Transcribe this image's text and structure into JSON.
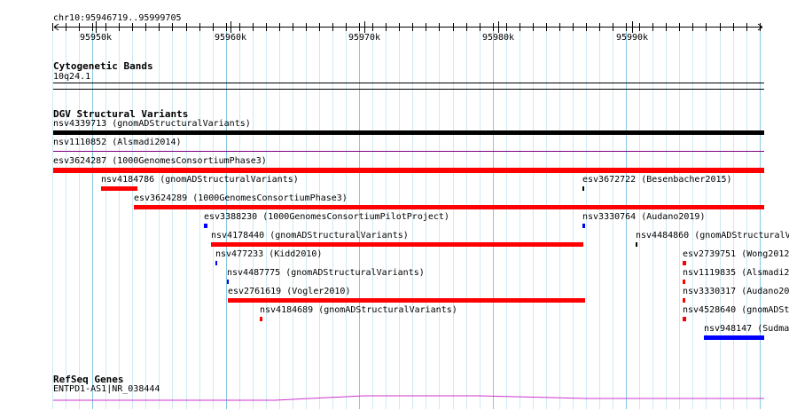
{
  "region": "chr10:95946719..95999705",
  "ruler": {
    "ticks": [
      "95950k",
      "95960k",
      "95970k",
      "95980k",
      "95990k"
    ]
  },
  "cytoband": {
    "title": "Cytogenetic Bands",
    "band": "10q24.1"
  },
  "dgv": {
    "title": "DGV Structural Variants",
    "colors": {
      "loss": "#ff0000",
      "gain": "#0000ff",
      "complex": "#000000",
      "inversion": "#800080"
    },
    "variants": [
      {
        "label": "nsv4339713 (gnomADStructuralVariants)",
        "type": "complex"
      },
      {
        "label": "nsv1110852 (Alsmadi2014)",
        "type": "inversion"
      },
      {
        "label": "esv3624287 (1000GenomesConsortiumPhase3)",
        "type": "loss"
      },
      {
        "label": "nsv4184786 (gnomADStructuralVariants)",
        "type": "loss"
      },
      {
        "label": "esv3672722 (Besenbacher2015)",
        "type": "complex"
      },
      {
        "label": "esv3624289 (1000GenomesConsortiumPhase3)",
        "type": "loss"
      },
      {
        "label": "esv3388230 (1000GenomesConsortiumPilotProject)",
        "type": "gain"
      },
      {
        "label": "nsv3330764 (Audano2019)",
        "type": "gain"
      },
      {
        "label": "nsv4178440 (gnomADStructuralVariants)",
        "type": "loss"
      },
      {
        "label": "nsv4484860 (gnomADStructuralV",
        "type": "complex"
      },
      {
        "label": "nsv477233 (Kidd2010)",
        "type": "gain"
      },
      {
        "label": "esv2739751 (Wong2012",
        "type": "loss"
      },
      {
        "label": "nsv4487775 (gnomADStructuralVariants)",
        "type": "gain"
      },
      {
        "label": "nsv1119835 (Alsmadi2",
        "type": "loss"
      },
      {
        "label": "esv2761619 (Vogler2010)",
        "type": "loss"
      },
      {
        "label": "nsv3330317 (Audano20",
        "type": "loss"
      },
      {
        "label": "nsv4184689 (gnomADStructuralVariants)",
        "type": "loss"
      },
      {
        "label": "nsv4528640 (gnomADSt",
        "type": "loss"
      },
      {
        "label": "nsv948147 (Sudma",
        "type": "gain"
      }
    ]
  },
  "refseq": {
    "title": "RefSeq Genes",
    "genes": [
      {
        "label": "ENTPD1-AS1|NR_038444",
        "color": "#cc33cc"
      }
    ]
  }
}
